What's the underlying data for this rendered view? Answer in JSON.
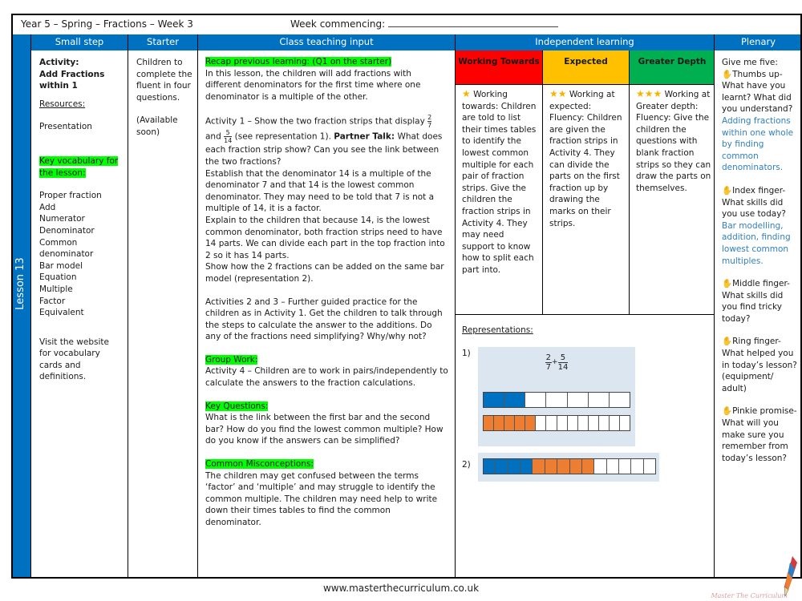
{
  "title": {
    "left": "Year 5 – Spring – Fractions – Week 3",
    "week_label": "Week commencing:"
  },
  "headers": {
    "small_step": "Small step",
    "starter": "Starter",
    "class_teaching": "Class teaching input",
    "independent": "Independent learning",
    "plenary": "Plenary"
  },
  "lesson_label": "Lesson 13",
  "small_step": {
    "activity_label": "Activity:",
    "activity_name_1": "Add Fractions",
    "activity_name_2": "within 1",
    "resources_label": "Resources:",
    "resources": "Presentation",
    "vocab_heading_1": "Key vocabulary for",
    "vocab_heading_2": "the lesson:",
    "vocabulary": [
      "Proper fraction",
      "Add",
      "Numerator",
      "Denominator",
      "Common",
      "denominator",
      "Bar model",
      "Equation",
      "Multiple",
      "Factor",
      "Equivalent"
    ],
    "website_note": "Visit the website for vocabulary cards and definitions."
  },
  "starter": {
    "text": "Children to complete the fluent in four questions.",
    "note": "(Available soon)"
  },
  "teaching": {
    "recap_heading": "Recap previous learning: (Q1 on the starter)",
    "intro": "In this lesson, the children will add fractions with different denominators for the first time where one denominator is a multiple of the other.",
    "activity1_a": "Activity 1 – Show the two fraction strips that display",
    "frac1_num": "2",
    "frac1_den": "7",
    "and_word": "and",
    "frac2_num": "5",
    "frac2_den": "14",
    "activity1_b": "(see representation 1).",
    "partner_talk_label": "Partner Talk:",
    "activity1_c": "What does each fraction strip show? Can you see the link between the two fractions?",
    "establish": "Establish that the denominator 14 is a multiple of the denominator 7 and that 14 is the lowest common denominator. They may need to be told that 7 is not a multiple of 14, it is a factor.",
    "explain": "Explain to the children that because 14, is the lowest common denominator, both fraction strips need to have 14 parts. We can divide each part in the top fraction into 2 so it has 14 parts.",
    "show": "Show how the 2 fractions can be added on the same bar model (representation 2).",
    "activities23": "Activities 2 and 3 – Further guided practice for the children as in Activity 1. Get the children to talk through the steps to calculate the answer to the additions. Do any of the fractions need simplifying? Why/why not?",
    "group_work_heading": "Group Work:",
    "group_work": "Activity 4 – Children are to work in pairs/independently to calculate the answers to the fraction calculations.",
    "key_questions_heading": "Key Questions:",
    "key_questions": "What is the link between the first bar and the second bar? How do you find the lowest common multiple? How do you know if the answers can be simplified?",
    "misconceptions_heading": "Common Misconceptions:",
    "misconceptions": "The children may get confused between the terms ‘factor’ and ‘multiple’ and may struggle to identify the common multiple. The children may need  help to write down their times tables to find the common denominator."
  },
  "independent": {
    "levels": [
      {
        "label": "Working Towards",
        "color": "#ff0000",
        "stars": "★",
        "intro": "Working towards:",
        "text": "Children are told to list their times tables to identify the lowest common multiple for each pair of fraction strips. Give the children the fraction strips in Activity 4. They may need support to know how to split each part into."
      },
      {
        "label": "Expected",
        "color": "#ffc000",
        "stars": "★★",
        "intro": "Working at expected:",
        "text": "Fluency: Children are given the fraction strips in Activity 4. They can divide the parts on the first fraction up by drawing the marks on their strips."
      },
      {
        "label": "Greater Depth",
        "color": "#00b050",
        "stars": "★★★",
        "intro": "Working at Greater depth:",
        "text": "Fluency: Give the children the questions with blank fraction strips so they can draw the parts on themselves."
      }
    ],
    "representations_label": "Representations:",
    "rep1": {
      "label": "1)",
      "frac_a_num": "2",
      "frac_a_den": "7",
      "plus": "+",
      "frac_b_num": "5",
      "frac_b_den": "14",
      "strip_a": {
        "parts": 7,
        "shaded": 2,
        "color": "#0070c0"
      },
      "strip_b": {
        "parts": 14,
        "shaded": 5,
        "color": "#ed7d31"
      }
    },
    "rep2": {
      "label": "2)",
      "strip": {
        "parts": 14,
        "blue": 4,
        "orange": 5
      }
    }
  },
  "plenary": {
    "intro": "Give me five:",
    "items": [
      {
        "icon": "hand",
        "prompt": "Thumbs up- What have you learnt? What did you understand?",
        "answer": "Adding fractions within one whole by finding common denominators."
      },
      {
        "icon": "hand",
        "prompt": "Index finger- What skills did you use today?",
        "answer": "Bar modelling, addition, finding lowest common multiples."
      },
      {
        "icon": "hand",
        "prompt": "Middle finger- What skills did you find tricky today?",
        "answer": ""
      },
      {
        "icon": "hand",
        "prompt": "Ring finger- What helped you in today’s lesson? (equipment/ adult)",
        "answer": ""
      },
      {
        "icon": "hand",
        "prompt": "Pinkie promise- What will you make sure you remember from today’s lesson?",
        "answer": ""
      }
    ]
  },
  "footer": {
    "url": "www.masterthecurriculum.co.uk",
    "brand": "Master The Curriculum"
  }
}
